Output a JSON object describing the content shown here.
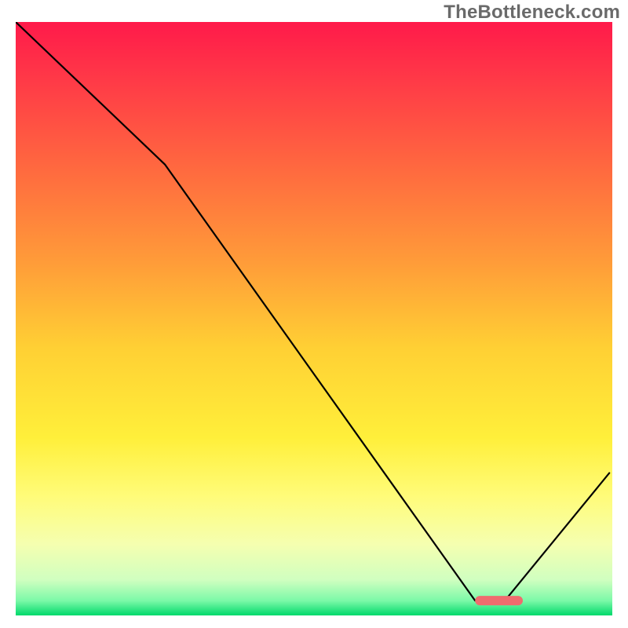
{
  "watermark": "TheBottleneck.com",
  "chart_data": {
    "type": "line",
    "title": "",
    "xlabel": "",
    "ylabel": "",
    "ylim": [
      0,
      100
    ],
    "xlim": [
      0,
      100
    ],
    "x": [
      0,
      25,
      77,
      82,
      99.5
    ],
    "values": [
      100,
      76,
      2.5,
      2.5,
      24
    ],
    "marker": {
      "x_start": 77,
      "x_end": 85,
      "y": 2.5,
      "color": "#ef6c6e"
    },
    "gradient_stops": [
      {
        "offset": 0,
        "color": "#ff1a4a"
      },
      {
        "offset": 0.1,
        "color": "#ff3a47"
      },
      {
        "offset": 0.25,
        "color": "#ff6a3f"
      },
      {
        "offset": 0.4,
        "color": "#ff9a39"
      },
      {
        "offset": 0.55,
        "color": "#ffd034"
      },
      {
        "offset": 0.7,
        "color": "#ffef3a"
      },
      {
        "offset": 0.8,
        "color": "#fffc7a"
      },
      {
        "offset": 0.88,
        "color": "#f5ffb0"
      },
      {
        "offset": 0.94,
        "color": "#d0ffc0"
      },
      {
        "offset": 0.975,
        "color": "#7cf9a8"
      },
      {
        "offset": 1.0,
        "color": "#00d96b"
      }
    ]
  }
}
